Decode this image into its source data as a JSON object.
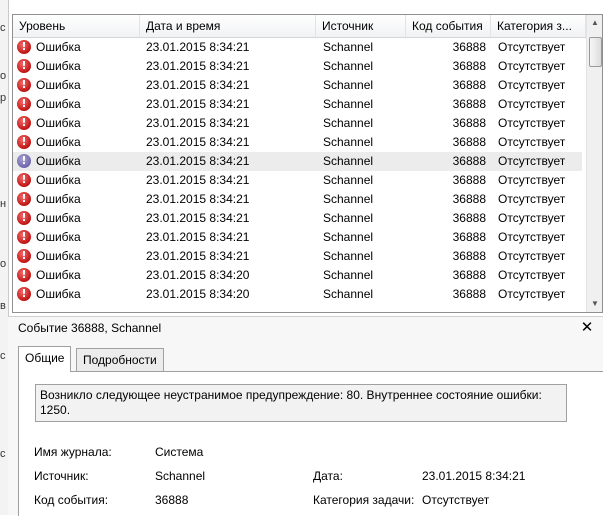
{
  "grid": {
    "columns": [
      "Уровень",
      "Дата и время",
      "Источник",
      "Код события",
      "Категория з..."
    ],
    "rows": [
      {
        "level": "Ошибка",
        "datetime": "23.01.2015 8:34:21",
        "source": "Schannel",
        "event_id": "36888",
        "category": "Отсутствует"
      },
      {
        "level": "Ошибка",
        "datetime": "23.01.2015 8:34:21",
        "source": "Schannel",
        "event_id": "36888",
        "category": "Отсутствует"
      },
      {
        "level": "Ошибка",
        "datetime": "23.01.2015 8:34:21",
        "source": "Schannel",
        "event_id": "36888",
        "category": "Отсутствует"
      },
      {
        "level": "Ошибка",
        "datetime": "23.01.2015 8:34:21",
        "source": "Schannel",
        "event_id": "36888",
        "category": "Отсутствует"
      },
      {
        "level": "Ошибка",
        "datetime": "23.01.2015 8:34:21",
        "source": "Schannel",
        "event_id": "36888",
        "category": "Отсутствует"
      },
      {
        "level": "Ошибка",
        "datetime": "23.01.2015 8:34:21",
        "source": "Schannel",
        "event_id": "36888",
        "category": "Отсутствует"
      },
      {
        "level": "Ошибка",
        "datetime": "23.01.2015 8:34:21",
        "source": "Schannel",
        "event_id": "36888",
        "category": "Отсутствует",
        "selected": true
      },
      {
        "level": "Ошибка",
        "datetime": "23.01.2015 8:34:21",
        "source": "Schannel",
        "event_id": "36888",
        "category": "Отсутствует"
      },
      {
        "level": "Ошибка",
        "datetime": "23.01.2015 8:34:21",
        "source": "Schannel",
        "event_id": "36888",
        "category": "Отсутствует"
      },
      {
        "level": "Ошибка",
        "datetime": "23.01.2015 8:34:21",
        "source": "Schannel",
        "event_id": "36888",
        "category": "Отсутствует"
      },
      {
        "level": "Ошибка",
        "datetime": "23.01.2015 8:34:21",
        "source": "Schannel",
        "event_id": "36888",
        "category": "Отсутствует"
      },
      {
        "level": "Ошибка",
        "datetime": "23.01.2015 8:34:21",
        "source": "Schannel",
        "event_id": "36888",
        "category": "Отсутствует"
      },
      {
        "level": "Ошибка",
        "datetime": "23.01.2015 8:34:20",
        "source": "Schannel",
        "event_id": "36888",
        "category": "Отсутствует"
      },
      {
        "level": "Ошибка",
        "datetime": "23.01.2015 8:34:20",
        "source": "Schannel",
        "event_id": "36888",
        "category": "Отсутствует"
      }
    ],
    "level_icon": "error-icon"
  },
  "detail": {
    "title": "Событие 36888, Schannel",
    "tabs": [
      "Общие",
      "Подробности"
    ],
    "message": "Возникло следующее неустранимое предупреждение: 80. Внутреннее состояние ошибки: 1250.",
    "fields": {
      "log_name_label": "Имя журнала:",
      "log_name_value": "Система",
      "source_label": "Источник:",
      "source_value": "Schannel",
      "date_label": "Дата:",
      "date_value": "23.01.2015 8:34:21",
      "event_id_label": "Код события:",
      "event_id_value": "36888",
      "task_category_label": "Категория задачи:",
      "task_category_value": "Отсутствует"
    }
  },
  "left_strip_chars": [
    "с",
    "о",
    "р",
    "н",
    "о",
    "в",
    "с",
    "с"
  ]
}
